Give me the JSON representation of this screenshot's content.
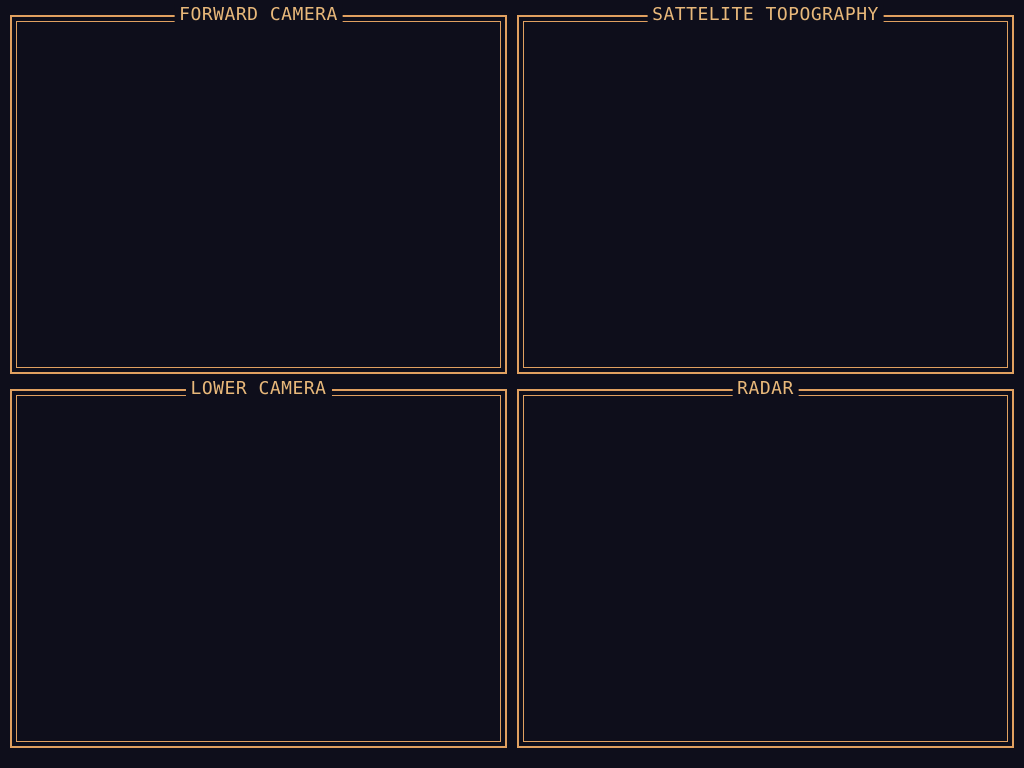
{
  "theme": {
    "background": "#0e0e1b",
    "frame_color": "#e0a060",
    "title_color": "#e8b87a"
  },
  "panels": {
    "forward_camera": {
      "title": "FORWARD CAMERA"
    },
    "satellite_topography": {
      "title": "SATTELITE TOPOGRAPHY"
    },
    "lower_camera": {
      "title": "LOWER CAMERA"
    },
    "radar": {
      "title": "RADAR"
    }
  }
}
